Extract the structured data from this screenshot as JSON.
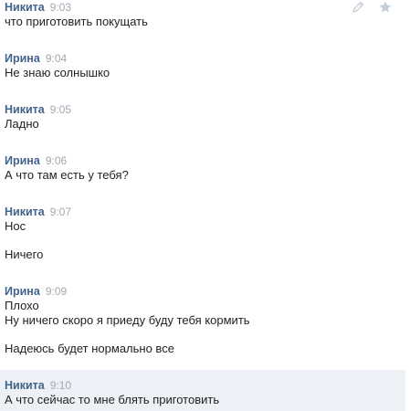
{
  "messages": [
    {
      "author": "Никита",
      "time": "9:03",
      "lines": [
        "что приготовить покущать"
      ]
    },
    {
      "author": "Ирина",
      "time": "9:04",
      "lines": [
        "Не знаю солнышко"
      ]
    },
    {
      "author": "Никита",
      "time": "9:05",
      "lines": [
        "Ладно"
      ]
    },
    {
      "author": "Ирина",
      "time": "9:06",
      "lines": [
        "А что там есть у тебя?"
      ]
    },
    {
      "author": "Никита",
      "time": "9:07",
      "lines": [
        "Нос",
        "Ничего"
      ]
    },
    {
      "author": "Ирина",
      "time": "9:09",
      "lines": [
        "Плохо",
        "Ну ничего скоро я приеду буду тебя кормить",
        "Надеюсь будет нормально все"
      ]
    },
    {
      "author": "Никита",
      "time": "9:10",
      "lines": [
        "А что сейчас то мне блять приготовить"
      ]
    }
  ],
  "actions": {
    "edit_icon": "pencil-icon",
    "star_icon": "star-icon"
  },
  "colors": {
    "author": "#42648b",
    "time": "#a2a9b2",
    "text": "#222222",
    "highlight_bg": "#edf0f5",
    "icon": "#c5cdd6"
  }
}
